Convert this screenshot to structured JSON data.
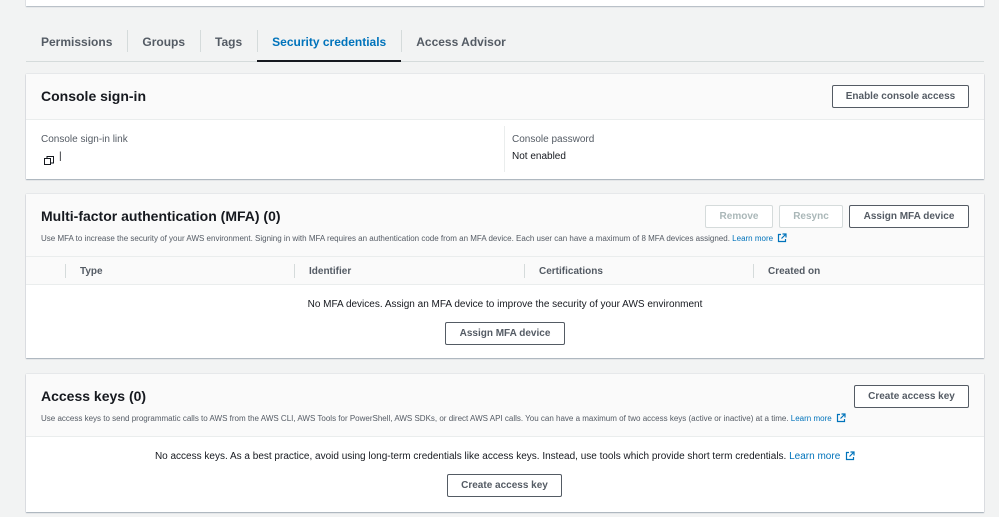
{
  "tabs": [
    {
      "label": "Permissions",
      "active": false
    },
    {
      "label": "Groups",
      "active": false
    },
    {
      "label": "Tags",
      "active": false
    },
    {
      "label": "Security credentials",
      "active": true
    },
    {
      "label": "Access Advisor",
      "active": false
    }
  ],
  "console_signin": {
    "title": "Console sign-in",
    "enable_button": "Enable console access",
    "link_label": "Console sign-in link",
    "link_value": "|",
    "password_label": "Console password",
    "password_value": "Not enabled"
  },
  "mfa": {
    "title": "Multi-factor authentication (MFA) (0)",
    "remove_button": "Remove",
    "resync_button": "Resync",
    "assign_button": "Assign MFA device",
    "description": "Use MFA to increase the security of your AWS environment. Signing in with MFA requires an authentication code from an MFA device. Each user can have a maximum of 8 MFA devices assigned.",
    "learn_more": "Learn more",
    "columns": [
      "Type",
      "Identifier",
      "Certifications",
      "Created on"
    ],
    "empty_message": "No MFA devices. Assign an MFA device to improve the security of your AWS environment",
    "empty_button": "Assign MFA device"
  },
  "access_keys": {
    "title": "Access keys (0)",
    "create_button": "Create access key",
    "description": "Use access keys to send programmatic calls to AWS from the AWS CLI, AWS Tools for PowerShell, AWS SDKs, or direct AWS API calls. You can have a maximum of two access keys (active or inactive) at a time.",
    "learn_more": "Learn more",
    "empty_message": "No access keys. As a best practice, avoid using long-term credentials like access keys. Instead, use tools which provide short term credentials.",
    "empty_learn_more": "Learn more",
    "empty_button": "Create access key"
  },
  "colors": {
    "link": "#0073bb",
    "text": "#16191f",
    "muted": "#545b64",
    "disabled": "#aab7b8",
    "background": "#f2f3f3"
  }
}
